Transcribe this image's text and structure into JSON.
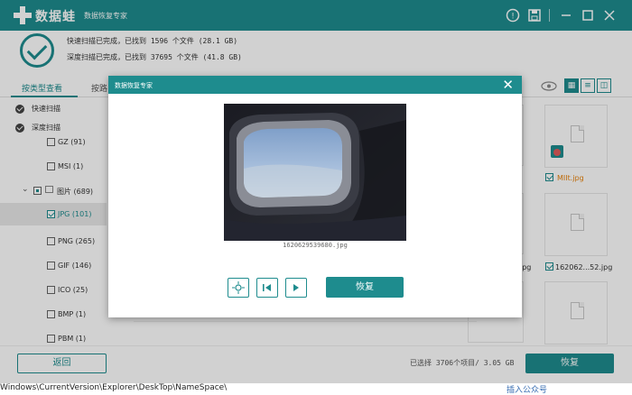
{
  "titlebar": {
    "brand": "数据蛙",
    "subtitle": "数据恢复专家",
    "icons": [
      "help-icon",
      "save-icon",
      "minimize-icon",
      "maximize-icon",
      "close-icon"
    ]
  },
  "scan": {
    "quick": "快速扫描已完成，已找到 1596 个文件 (28.1 GB)",
    "deep": "深度扫描已完成，已找到 37695 个文件 (41.8 GB)"
  },
  "tabs": [
    {
      "label": "按类型查看",
      "active": true
    },
    {
      "label": "按路",
      "active": false
    }
  ],
  "sidebar": {
    "scan_modes": [
      "快速扫描",
      "深度扫描"
    ],
    "items": [
      {
        "label": "GZ (91)"
      },
      {
        "label": "MSI (1)"
      },
      {
        "label": "图片 (689)"
      },
      {
        "label": "JPG (101)"
      },
      {
        "label": "PNG (265)"
      },
      {
        "label": "GIF (146)"
      },
      {
        "label": "ICO (25)"
      },
      {
        "label": "BMP (1)"
      },
      {
        "label": "PBM (1)"
      }
    ]
  },
  "gallery": {
    "files": [
      {
        "name": "MIIt.jpg"
      },
      {
        "name": "162062...52.jpg"
      },
      {
        "name": "jpg"
      }
    ]
  },
  "bottom": {
    "back": "返回",
    "selection": "已选择 3706个项目/ 3.05 GB",
    "recover": "恢复"
  },
  "background_text": {
    "path": "Windows\\CurrentVersion\\Explorer\\DeskTop\\NameSpace\\",
    "link": "插入公众号"
  },
  "modal": {
    "title": "数据恢复专家",
    "filename": "1620629539680.jpg",
    "recover": "恢复",
    "controls": [
      "locate-icon",
      "previous-icon",
      "next-icon"
    ]
  },
  "colors": {
    "accent": "#1e8c8e",
    "file_name_warning": "#e8820c"
  }
}
